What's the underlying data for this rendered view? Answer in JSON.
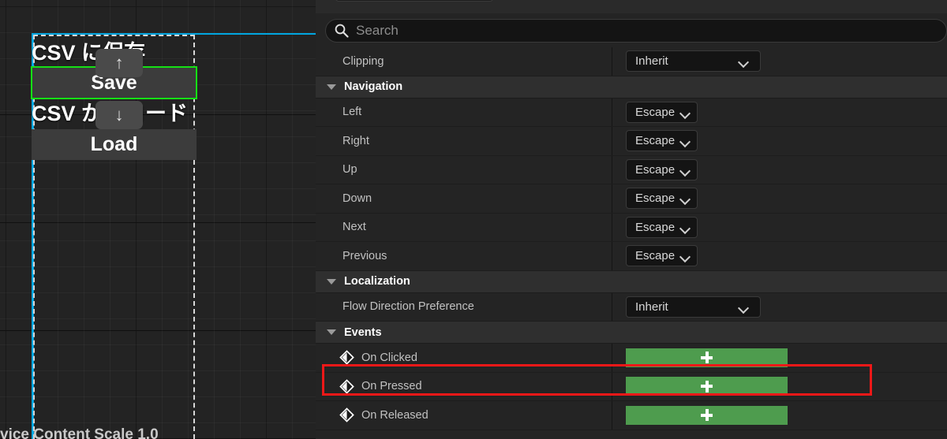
{
  "designer": {
    "labels": [
      {
        "text": "CSV に保存",
        "name": "csv-save-label"
      },
      {
        "text": "CSV からロード",
        "name": "csv-load-label"
      }
    ],
    "buttons": [
      {
        "text": "Save",
        "name": "save-button"
      },
      {
        "text": "Load",
        "name": "load-button"
      }
    ],
    "handles": [
      {
        "glyph": "↑",
        "name": "move-up-handle"
      },
      {
        "glyph": "↓",
        "name": "move-down-handle"
      }
    ],
    "footer_text": "vice Content Scale 1.0",
    "selection_color": "#15e015",
    "guide_color": "#00a6e0"
  },
  "details": {
    "search": {
      "placeholder": "Search",
      "value": "",
      "icon": "search-icon"
    },
    "rows": [
      {
        "type": "property",
        "label": "Clipping",
        "control": "combo-wide",
        "value": "Inherit"
      },
      {
        "type": "section",
        "label": "Navigation",
        "expanded": true
      },
      {
        "type": "property",
        "label": "Left",
        "control": "combo-narrow",
        "value": "Escape"
      },
      {
        "type": "property",
        "label": "Right",
        "control": "combo-narrow",
        "value": "Escape"
      },
      {
        "type": "property",
        "label": "Up",
        "control": "combo-narrow",
        "value": "Escape"
      },
      {
        "type": "property",
        "label": "Down",
        "control": "combo-narrow",
        "value": "Escape"
      },
      {
        "type": "property",
        "label": "Next",
        "control": "combo-narrow",
        "value": "Escape"
      },
      {
        "type": "property",
        "label": "Previous",
        "control": "combo-narrow",
        "value": "Escape"
      },
      {
        "type": "section",
        "label": "Localization",
        "expanded": true
      },
      {
        "type": "property",
        "label": "Flow Direction Preference",
        "control": "combo-wide",
        "value": "Inherit"
      },
      {
        "type": "section",
        "label": "Events",
        "expanded": true
      },
      {
        "type": "event",
        "label": "On Clicked",
        "button": "add-binding",
        "highlighted": true
      },
      {
        "type": "event",
        "label": "On Pressed",
        "button": "add-binding",
        "highlighted": false
      },
      {
        "type": "event",
        "label": "On Released",
        "button": "add-binding",
        "highlighted": false
      }
    ],
    "colors": {
      "add_button": "#4e9c4e",
      "highlight_outline": "#f01818",
      "row_background": "#242424",
      "section_background": "#2f2f2f"
    }
  }
}
